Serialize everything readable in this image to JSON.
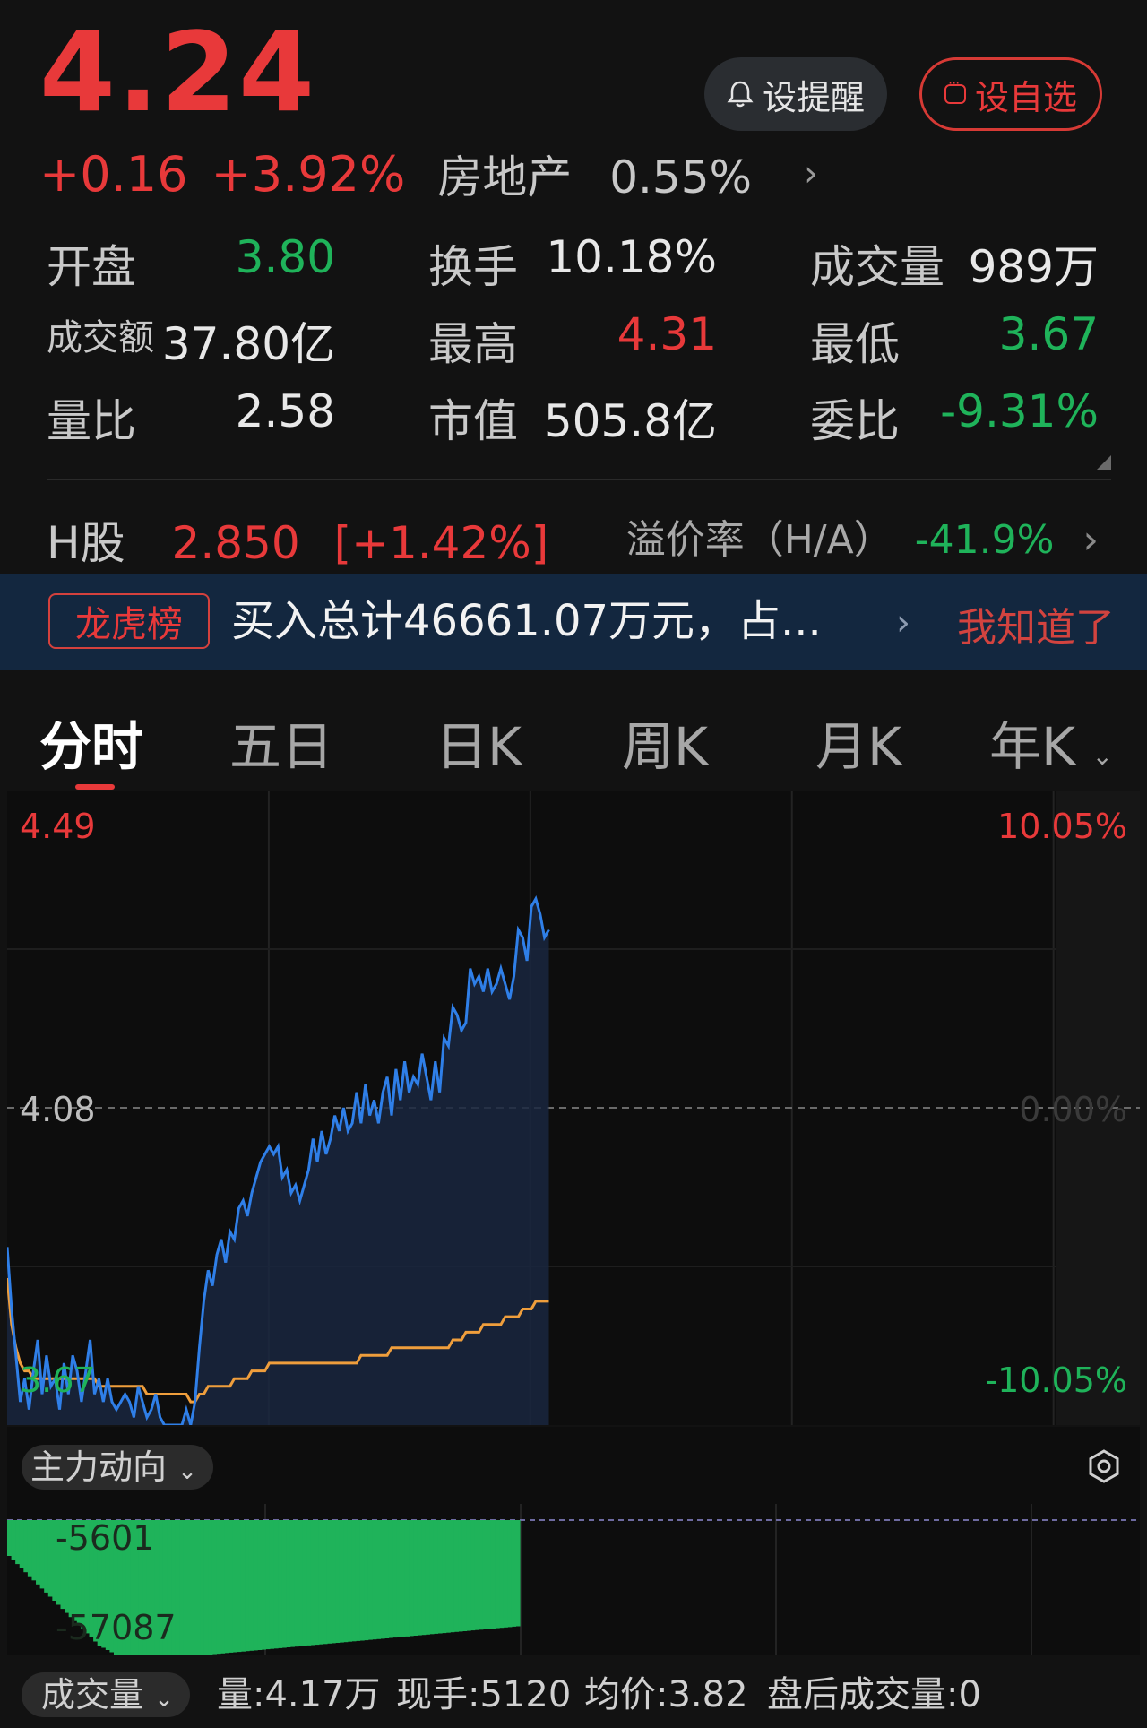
{
  "quote": {
    "price": "4.24",
    "change": "+0.16",
    "change_pct": "+3.92%",
    "sector_name": "房地产",
    "sector_pct": "0.55%",
    "alert_label": "设提醒",
    "watch_label": "设自选"
  },
  "stats": {
    "open_label": "开盘",
    "open_value": "3.80",
    "turnover_label": "换手",
    "turnover_value": "10.18%",
    "volume_label": "成交量",
    "volume_value": "989万",
    "amount_label": "成交额",
    "amount_value": "37.80亿",
    "high_label": "最高",
    "high_value": "4.31",
    "low_label": "最低",
    "low_value": "3.67",
    "vol_ratio_label": "量比",
    "vol_ratio_value": "2.58",
    "mktcap_label": "市值",
    "mktcap_value": "505.8亿",
    "bid_ratio_label": "委比",
    "bid_ratio_value": "-9.31%"
  },
  "hshare": {
    "label": "H股",
    "price": "2.850",
    "pct": "[+1.42%]",
    "premium_label": "溢价率（H/A）",
    "premium_value": "-41.9%"
  },
  "banner": {
    "tag": "龙虎榜",
    "text": "买入总计46661.07万元，占...",
    "ack": "我知道了"
  },
  "tabs": [
    "分时",
    "五日",
    "日K",
    "周K",
    "月K",
    "年K"
  ],
  "chart_data": {
    "type": "line",
    "y_left_labels": {
      "top": "4.49",
      "mid": "4.08",
      "bottom": "3.67"
    },
    "y_right_labels": {
      "top": "10.05%",
      "mid": "0.00%",
      "bottom": "-10.05%"
    },
    "ylim": [
      3.67,
      4.49
    ],
    "prev_close": 4.08,
    "x_range": [
      0,
      240
    ],
    "series": [
      {
        "values": [
          3.9,
          3.82,
          3.76,
          3.7,
          3.73,
          3.69,
          3.74,
          3.78,
          3.71,
          3.76,
          3.72,
          3.73,
          3.69,
          3.75,
          3.71,
          3.76,
          3.74,
          3.7,
          3.74,
          3.78,
          3.71,
          3.73,
          3.7,
          3.73,
          3.7,
          3.69,
          3.7,
          3.71,
          3.7,
          3.68,
          3.72,
          3.7,
          3.68,
          3.69,
          3.71,
          3.68,
          3.67,
          3.67,
          3.67,
          3.67,
          3.67,
          3.69,
          3.67,
          3.7,
          3.77,
          3.83,
          3.87,
          3.85,
          3.89,
          3.91,
          3.88,
          3.92,
          3.91,
          3.95,
          3.96,
          3.94,
          3.97,
          3.99,
          4.01,
          4.02,
          4.03,
          4.02,
          4.03,
          3.99,
          4.0,
          3.97,
          3.98,
          3.96,
          3.98,
          4.0,
          4.04,
          4.01,
          4.05,
          4.02,
          4.04,
          4.07,
          4.05,
          4.08,
          4.05,
          4.06,
          4.1,
          4.06,
          4.11,
          4.07,
          4.09,
          4.06,
          4.1,
          4.12,
          4.07,
          4.13,
          4.09,
          4.14,
          4.1,
          4.12,
          4.11,
          4.15,
          4.12,
          4.09,
          4.14,
          4.1,
          4.17,
          4.16,
          4.21,
          4.2,
          4.18,
          4.19,
          4.26,
          4.24,
          4.25,
          4.23,
          4.26,
          4.23,
          4.24,
          4.26,
          4.24,
          4.22,
          4.25,
          4.31,
          4.3,
          4.27,
          4.34,
          4.35,
          4.33,
          4.3,
          4.31
        ],
        "color": "#2f7fe8"
      },
      {
        "values": [
          3.86,
          3.8,
          3.77,
          3.75,
          3.74,
          3.74,
          3.73,
          3.73,
          3.73,
          3.73,
          3.73,
          3.73,
          3.73,
          3.73,
          3.73,
          3.73,
          3.73,
          3.73,
          3.73,
          3.73,
          3.73,
          3.72,
          3.72,
          3.72,
          3.72,
          3.72,
          3.72,
          3.72,
          3.72,
          3.72,
          3.72,
          3.72,
          3.71,
          3.71,
          3.71,
          3.71,
          3.71,
          3.71,
          3.71,
          3.71,
          3.71,
          3.71,
          3.7,
          3.7,
          3.71,
          3.71,
          3.72,
          3.72,
          3.72,
          3.72,
          3.72,
          3.72,
          3.73,
          3.73,
          3.73,
          3.73,
          3.74,
          3.74,
          3.74,
          3.74,
          3.75,
          3.75,
          3.75,
          3.75,
          3.75,
          3.75,
          3.75,
          3.75,
          3.75,
          3.75,
          3.75,
          3.75,
          3.75,
          3.75,
          3.75,
          3.75,
          3.75,
          3.75,
          3.75,
          3.75,
          3.75,
          3.76,
          3.76,
          3.76,
          3.76,
          3.76,
          3.76,
          3.76,
          3.77,
          3.77,
          3.77,
          3.77,
          3.77,
          3.77,
          3.77,
          3.77,
          3.77,
          3.77,
          3.77,
          3.77,
          3.77,
          3.77,
          3.78,
          3.78,
          3.78,
          3.79,
          3.79,
          3.79,
          3.79,
          3.8,
          3.8,
          3.8,
          3.8,
          3.8,
          3.81,
          3.81,
          3.81,
          3.81,
          3.82,
          3.82,
          3.82,
          3.83,
          3.83,
          3.83,
          3.83
        ],
        "color": "#ef9e3c"
      }
    ]
  },
  "indicator": {
    "name": "主力动向",
    "top_label": "-5601",
    "bottom_label": "-57087",
    "bar_color": "#1fb35a"
  },
  "bottom_bar": {
    "selector": "成交量",
    "volume": "量:4.17万",
    "current_hand": "现手:5120",
    "avg_price": "均价:3.82",
    "after_hours": "盘后成交量:0"
  }
}
